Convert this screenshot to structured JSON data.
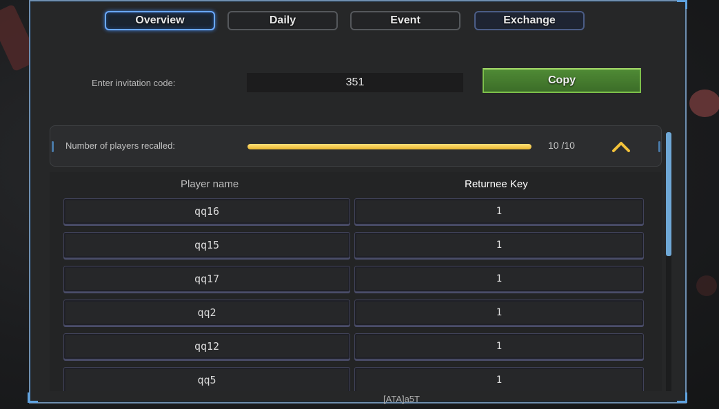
{
  "tabs": [
    {
      "label": "Overview",
      "active": true
    },
    {
      "label": "Daily",
      "active": false
    },
    {
      "label": "Event",
      "active": false
    },
    {
      "label": "Exchange",
      "active": false
    }
  ],
  "invite": {
    "label": "Enter invitation code:",
    "code": "351",
    "copy_label": "Copy"
  },
  "recall": {
    "label": "Number of players recalled:",
    "count_text": "10 /10",
    "progress": 1.0,
    "expand_icon": "chevron-up-icon"
  },
  "table": {
    "header_name": "Player name",
    "header_key": "Returnee Key",
    "rows": [
      {
        "name": "qq16",
        "key": "1"
      },
      {
        "name": "qq15",
        "key": "1"
      },
      {
        "name": "qq17",
        "key": "1"
      },
      {
        "name": "qq2",
        "key": "1"
      },
      {
        "name": "qq12",
        "key": "1"
      },
      {
        "name": "qq5",
        "key": "1"
      }
    ]
  },
  "footer": {
    "player_tag": "[ATA]a5T"
  },
  "colors": {
    "accent_blue": "#6aa8ff",
    "copy_green": "#4f8a35",
    "progress_yellow": "#f0c040"
  }
}
